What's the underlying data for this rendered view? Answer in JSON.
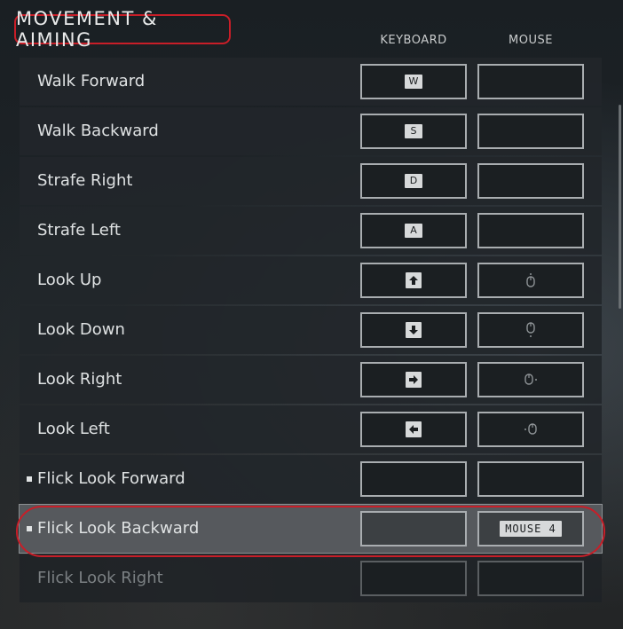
{
  "section": {
    "title": "MOVEMENT & AIMING"
  },
  "columns": {
    "keyboard": "KEYBOARD",
    "mouse": "MOUSE"
  },
  "accent_color": "#c81e28",
  "rows": [
    {
      "label": "Walk Forward",
      "keyboard": "W",
      "mouse": ""
    },
    {
      "label": "Walk Backward",
      "keyboard": "S",
      "mouse": ""
    },
    {
      "label": "Strafe Right",
      "keyboard": "D",
      "mouse": ""
    },
    {
      "label": "Strafe Left",
      "keyboard": "A",
      "mouse": ""
    },
    {
      "label": "Look Up",
      "keyboard_icon": "arrow-up-icon",
      "mouse_icon": "mouse-up-icon"
    },
    {
      "label": "Look Down",
      "keyboard_icon": "arrow-down-icon",
      "mouse_icon": "mouse-down-icon"
    },
    {
      "label": "Look Right",
      "keyboard_icon": "arrow-right-icon",
      "mouse_icon": "mouse-right-icon"
    },
    {
      "label": "Look Left",
      "keyboard_icon": "arrow-left-icon",
      "mouse_icon": "mouse-left-icon"
    },
    {
      "label": "Flick Look Forward",
      "keyboard": "",
      "mouse": "",
      "bullet": true
    },
    {
      "label": "Flick Look Backward",
      "keyboard": "",
      "mouse": "MOUSE 4",
      "bullet": true,
      "selected": true
    },
    {
      "label": "Flick Look Right",
      "keyboard": "",
      "mouse": "",
      "dimmed": true
    }
  ]
}
